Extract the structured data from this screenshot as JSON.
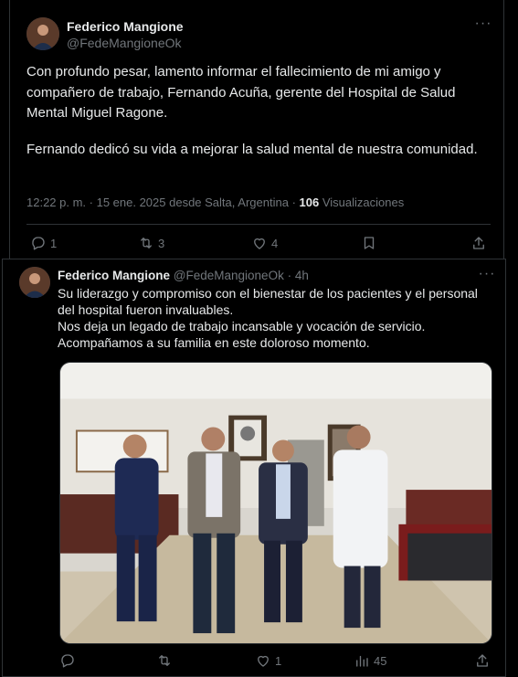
{
  "tweet1": {
    "author_name": "Federico Mangione",
    "author_handle": "@FedeMangioneOk",
    "paragraph1": "Con profundo pesar, lamento informar el fallecimiento de mi amigo y compañero de trabajo, Fernando Acuña, gerente del Hospital de Salud Mental Miguel Ragone.",
    "paragraph2": "Fernando dedicó su vida a mejorar la salud mental de nuestra comunidad.",
    "timestamp": "12:22 p. m. · 15 ene. 2025 desde Salta, Argentina",
    "separator": "·",
    "views_count": "106",
    "views_label": "Visualizaciones",
    "replies": "1",
    "reposts": "3",
    "likes": "4"
  },
  "tweet2": {
    "author_name": "Federico Mangione",
    "author_handle": "@FedeMangioneOk",
    "time": "· 4h",
    "line1": "Su liderazgo y compromiso con el bienestar de los pacientes y el personal del hospital fueron invaluables.",
    "line2": "Nos deja un legado de trabajo incansable y vocación de servicio.",
    "line3": "Acompañamos a su familia en este doloroso momento.",
    "replies": "",
    "reposts": "",
    "likes": "1",
    "views": "45"
  },
  "icons": {
    "more": "more-icon",
    "reply": "reply-icon",
    "repost": "repost-icon",
    "like": "heart-icon",
    "bookmark": "bookmark-icon",
    "share": "share-icon",
    "views": "views-icon"
  },
  "colors": {
    "background": "#000000",
    "text": "#e7e9ea",
    "muted": "#71767b",
    "border": "#2f3336"
  }
}
